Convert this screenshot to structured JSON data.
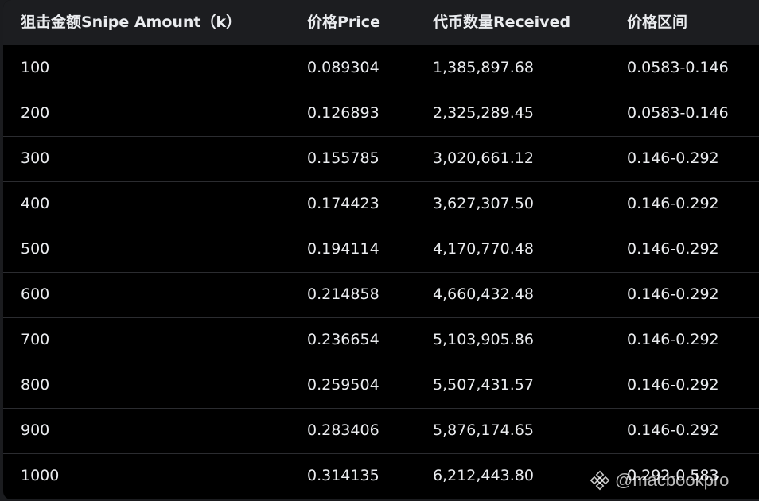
{
  "table": {
    "headers": [
      "狙击金额Snipe Amount（k）",
      "价格Price",
      "代币数量Received",
      "价格区间"
    ],
    "rows": [
      [
        "100",
        "0.089304",
        "1,385,897.68",
        "0.0583-0.146"
      ],
      [
        "200",
        "0.126893",
        "2,325,289.45",
        "0.0583-0.146"
      ],
      [
        "300",
        "0.155785",
        "3,020,661.12",
        "0.146-0.292"
      ],
      [
        "400",
        "0.174423",
        "3,627,307.50",
        "0.146-0.292"
      ],
      [
        "500",
        "0.194114",
        "4,170,770.48",
        "0.146-0.292"
      ],
      [
        "600",
        "0.214858",
        "4,660,432.48",
        "0.146-0.292"
      ],
      [
        "700",
        "0.236654",
        "5,103,905.86",
        "0.146-0.292"
      ],
      [
        "800",
        "0.259504",
        "5,507,431.57",
        "0.146-0.292"
      ],
      [
        "900",
        "0.283406",
        "5,876,174.65",
        "0.146-0.292"
      ],
      [
        "1000",
        "0.314135",
        "6,212,443.80",
        "0.292-0.583"
      ]
    ]
  },
  "watermark": {
    "handle": "@macbookpro",
    "icon": "binance-logo-icon"
  },
  "colors": {
    "background": "#000000",
    "header_background": "#1c1d20",
    "text": "#eaecef",
    "divider": "#2b2c30"
  }
}
